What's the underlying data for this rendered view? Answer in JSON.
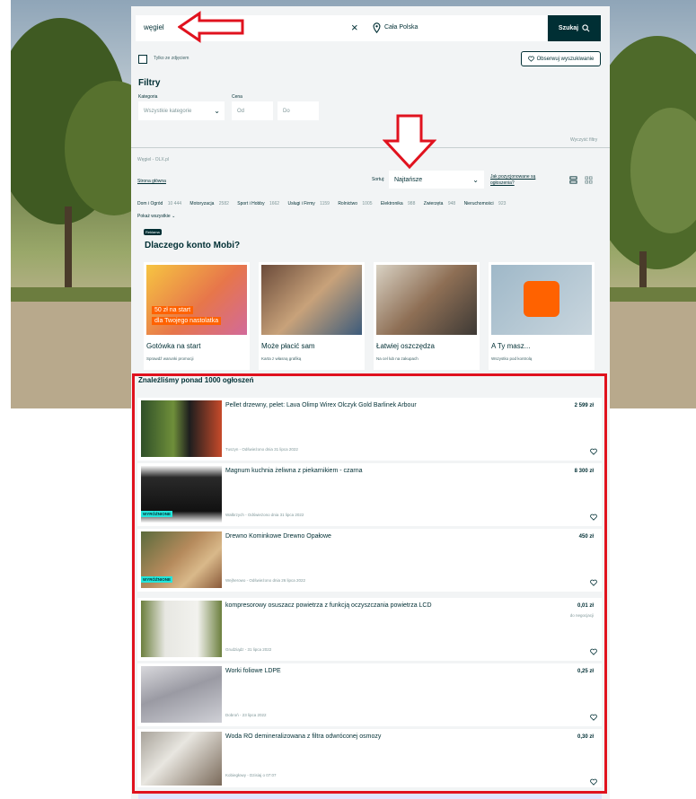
{
  "search": {
    "query": "węgiel",
    "location": "Cała Polska",
    "button": "Szukaj",
    "photo_only": "Tylko ze zdjęciem",
    "watch": "Obserwuj wyszukiwanie"
  },
  "filters": {
    "title": "Filtry",
    "category_label": "Kategoria",
    "category_value": "Wszystkie kategorie",
    "price_label": "Cena",
    "from": "Od",
    "to": "Do",
    "clear": "Wyczyść filtry"
  },
  "breadcrumb": "Węgiel - OLX.pl",
  "home": "Strona główna",
  "sort": {
    "label": "Sortuj:",
    "value": "Najtańsze",
    "help": "Jak pozycjonowane są ogłoszenia?"
  },
  "categories": [
    {
      "name": "Dom i Ogród",
      "count": "10 444"
    },
    {
      "name": "Motoryzacja",
      "count": "2582"
    },
    {
      "name": "Sport i Hobby",
      "count": "1662"
    },
    {
      "name": "Usługi i Firmy",
      "count": "1159"
    },
    {
      "name": "Rolnictwo",
      "count": "1005"
    },
    {
      "name": "Elektronika",
      "count": "988"
    },
    {
      "name": "Zwierzęta",
      "count": "948"
    },
    {
      "name": "Nieruchomości",
      "count": "923"
    }
  ],
  "show_all": "Pokaż wszystkie",
  "ad": {
    "tag": "Reklama",
    "title": "Dlaczego konto Mobi?",
    "cards": [
      {
        "title": "Gotówka na start",
        "sub": "Sprawdź warunki promocji",
        "overlay1": "50 zł na start",
        "overlay2": "dla Twojego nastolatka"
      },
      {
        "title": "Może płacić sam",
        "sub": "Karta z własną grafiką"
      },
      {
        "title": "Łatwiej oszczędza",
        "sub": "Na cel lub na zakupach"
      },
      {
        "title": "A Ty masz...",
        "sub": "Wszystko pod kontrolą"
      }
    ]
  },
  "results": {
    "heading": "Znaleźliśmy ponad 1000 ogłoszeń",
    "items": [
      {
        "title": "Pellet drzewny, pelet: Lava Olimp Wirex Olczyk Gold Barlinek Arbour",
        "price": "2 599 zł",
        "meta": "Tuszyn - Odświeżono dnia 31 lipca 2022",
        "badge": ""
      },
      {
        "title": "Magnum kuchnia żeliwna z piekarnikiem - czarna",
        "price": "8 300 zł",
        "meta": "Wałbrzych - Odświeżono dnia 31 lipca 2022",
        "badge": "WYRÓŻNIONE"
      },
      {
        "title": "Drewno Kominkowe Drewno Opałowe",
        "price": "450 zł",
        "meta": "Wejherowo - Odświeżono dnia 26 lipca 2022",
        "badge": "WYRÓŻNIONE"
      },
      {
        "title": "kompresorowy osuszacz powietrza z funkcją oczyszczania powietrza LCD",
        "price": "0,01 zł",
        "neg": "do negocjacji",
        "meta": "Grudziądz - 31 lipca 2022",
        "badge": ""
      },
      {
        "title": "Worki foliowe LDPE",
        "price": "0,25 zł",
        "meta": "Dobroń - 23 lipca 2022",
        "badge": ""
      },
      {
        "title": "Woda RO demineralizowana z filtra odwróconej osmozy",
        "price": "0,30 zł",
        "meta": "Kobiegłowy - Dzisiaj o 07:07",
        "badge": ""
      }
    ]
  },
  "colors": {
    "primary": "#002f34",
    "annotation": "#e0121e",
    "badge": "#23e5db"
  }
}
